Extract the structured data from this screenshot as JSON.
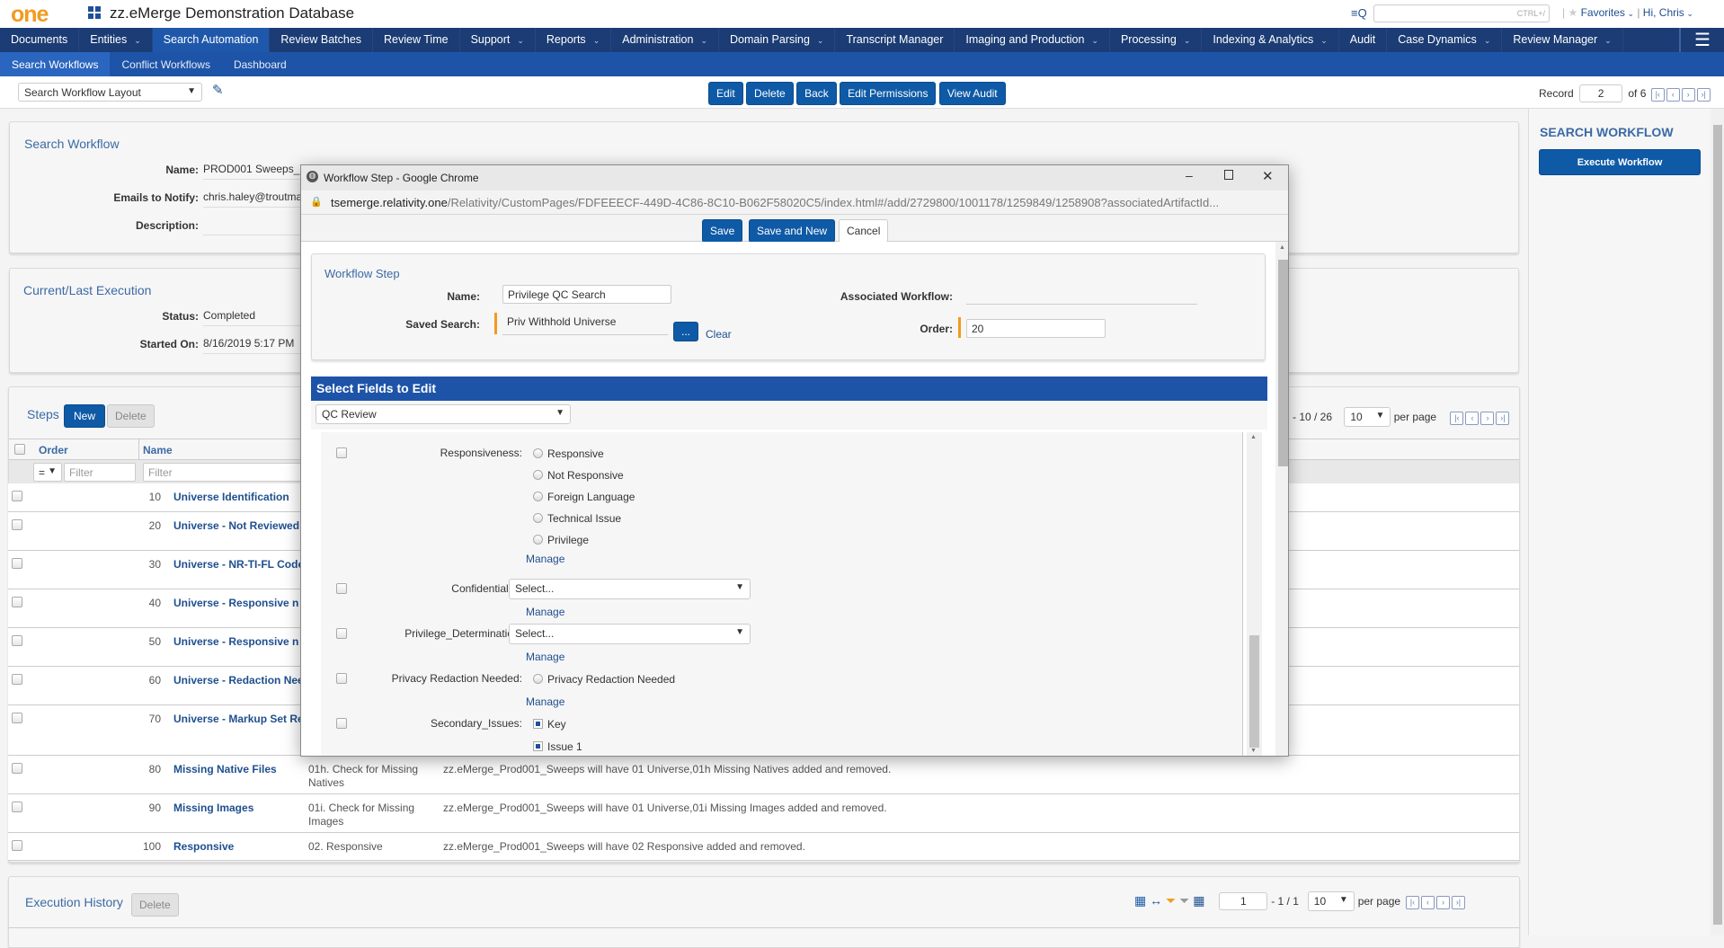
{
  "header": {
    "logo": "one",
    "workspace": "zz.eMerge Demonstration Database",
    "search_placeholder": "CTRL+/",
    "favorites": "Favorites",
    "user": "Hi, Chris"
  },
  "nav": [
    {
      "label": "Documents",
      "dd": false
    },
    {
      "label": "Entities",
      "dd": true
    },
    {
      "label": "Search Automation",
      "dd": false,
      "active": true
    },
    {
      "label": "Review Batches",
      "dd": false
    },
    {
      "label": "Review Time",
      "dd": false
    },
    {
      "label": "Support",
      "dd": true
    },
    {
      "label": "Reports",
      "dd": true
    },
    {
      "label": "Administration",
      "dd": true
    },
    {
      "label": "Domain Parsing",
      "dd": true
    },
    {
      "label": "Transcript Manager",
      "dd": false
    },
    {
      "label": "Imaging and Production",
      "dd": true
    },
    {
      "label": "Processing",
      "dd": true
    },
    {
      "label": "Indexing & Analytics",
      "dd": true
    },
    {
      "label": "Audit",
      "dd": false
    },
    {
      "label": "Case Dynamics",
      "dd": true
    },
    {
      "label": "Review Manager",
      "dd": true
    }
  ],
  "subnav": [
    "Search Workflows",
    "Conflict Workflows",
    "Dashboard"
  ],
  "toolbar": {
    "layout": "Search Workflow Layout",
    "edit": "Edit",
    "delete": "Delete",
    "back": "Back",
    "edit_permissions": "Edit Permissions",
    "view_audit": "View Audit",
    "record_label": "Record",
    "record": "2",
    "of": "of 6"
  },
  "workflow": {
    "title": "Search Workflow",
    "name_label": "Name:",
    "name": "PROD001 Sweeps_",
    "emails_label": "Emails to Notify:",
    "emails": "chris.haley@troutma",
    "desc_label": "Description:"
  },
  "execution": {
    "title": "Current/Last Execution",
    "status_label": "Status:",
    "status": "Completed",
    "started_label": "Started On:",
    "started": "8/16/2019 5:17 PM"
  },
  "steps": {
    "title": "Steps",
    "new": "New",
    "delete": "Delete",
    "col_order": "Order",
    "col_name": "Name",
    "op": "=",
    "filter": "Filter",
    "range": "- 10 / 26",
    "per_page_val": "10",
    "per_page": "per page",
    "rows": [
      {
        "order": "10",
        "name": "Universe Identification"
      },
      {
        "order": "20",
        "name": "Universe - Not Reviewed"
      },
      {
        "order": "30",
        "name": "Universe - NR-TI-FL Code"
      },
      {
        "order": "40",
        "name": "Universe - Responsive n"
      },
      {
        "order": "50",
        "name": "Universe - Responsive n"
      },
      {
        "order": "60",
        "name": "Universe - Redaction Nee"
      },
      {
        "order": "70",
        "name": "Universe - Markup Set Re"
      },
      {
        "order": "80",
        "name": "Missing Native Files",
        "search": "01h. Check for Missing Natives",
        "desc": "zz.eMerge_Prod001_Sweeps will have 01 Universe,01h Missing Natives added and removed."
      },
      {
        "order": "90",
        "name": "Missing Images",
        "search": "01i. Check for Missing Images",
        "desc": "zz.eMerge_Prod001_Sweeps will have 01 Universe,01i Missing Images added and removed."
      },
      {
        "order": "100",
        "name": "Responsive",
        "search": "02. Responsive",
        "desc": "zz.eMerge_Prod001_Sweeps will have 02 Responsive added and removed."
      }
    ]
  },
  "history": {
    "title": "Execution History",
    "delete": "Delete",
    "page": "1",
    "range": "- 1 / 1",
    "per_page_val": "10",
    "per_page": "per page"
  },
  "sidebar": {
    "title": "SEARCH WORKFLOW",
    "execute": "Execute Workflow"
  },
  "dialog": {
    "window_title": "Workflow Step - Google Chrome",
    "url_host": "tsemerge.relativity.one",
    "url_path": "/Relativity/CustomPages/FDFEEECF-449D-4C86-8C10-B062F58020C5/index.html#/add/2729800/1001178/1259849/1258908?associatedArtifactId...",
    "save": "Save",
    "save_new": "Save and New",
    "cancel": "Cancel",
    "section": "Workflow Step",
    "name_label": "Name:",
    "name": "Privilege QC Search",
    "saved_label": "Saved Search:",
    "saved": "Priv Withhold Universe",
    "browse": "...",
    "clear": "Clear",
    "assoc_label": "Associated Workflow:",
    "order_label": "Order:",
    "order": "20",
    "fields_header": "Select Fields to Edit",
    "layout": "QC Review",
    "responsiveness_label": "Responsiveness:",
    "responsiveness_options": [
      "Responsive",
      "Not Responsive",
      "Foreign Language",
      "Technical Issue",
      "Privilege"
    ],
    "manage": "Manage",
    "confidentiality_label": "Confidentiality:",
    "select": "Select...",
    "privdet_label": "Privilege_Determination:",
    "privacy_label": "Privacy Redaction Needed:",
    "privacy_option": "Privacy Redaction Needed",
    "secondary_label": "Secondary_Issues:",
    "secondary_options": [
      "Key",
      "Issue 1"
    ]
  }
}
